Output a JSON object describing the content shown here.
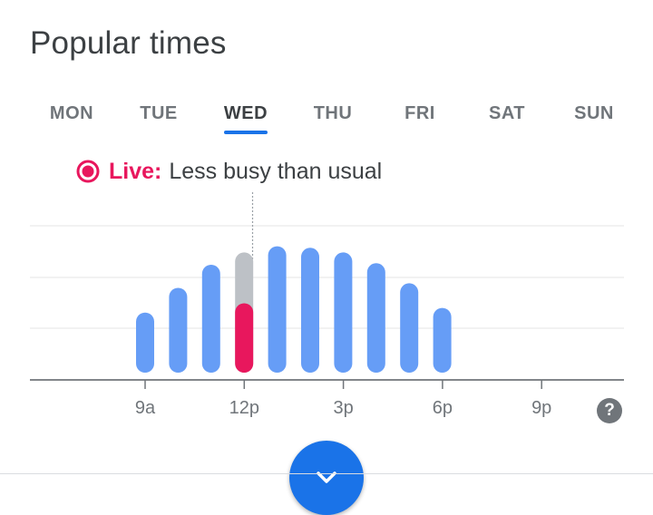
{
  "title": "Popular times",
  "days": [
    {
      "label": "MON",
      "active": false
    },
    {
      "label": "TUE",
      "active": false
    },
    {
      "label": "WED",
      "active": true
    },
    {
      "label": "THU",
      "active": false
    },
    {
      "label": "FRI",
      "active": false
    },
    {
      "label": "SAT",
      "active": false
    },
    {
      "label": "SUN",
      "active": false
    }
  ],
  "live": {
    "label": "Live:",
    "text": "Less busy than usual"
  },
  "colors": {
    "bar": "#669df6",
    "live": "#e8175d",
    "usual": "#bdc1c6",
    "accent": "#1a73e8"
  },
  "chart_data": {
    "type": "bar",
    "x_ticks": [
      "9a",
      "12p",
      "3p",
      "6p",
      "9p"
    ],
    "categories": [
      "9a",
      "10a",
      "11a",
      "12p",
      "1p",
      "2p",
      "3p",
      "4p",
      "5p",
      "6p"
    ],
    "values": [
      39,
      55,
      70,
      78,
      82,
      81,
      78,
      71,
      58,
      42
    ],
    "live": {
      "hour": "12p",
      "value": 45
    },
    "ylim": [
      0,
      100
    ],
    "grid": true
  },
  "help_icon": "question-mark-icon",
  "expand_icon": "chevron-down-icon"
}
